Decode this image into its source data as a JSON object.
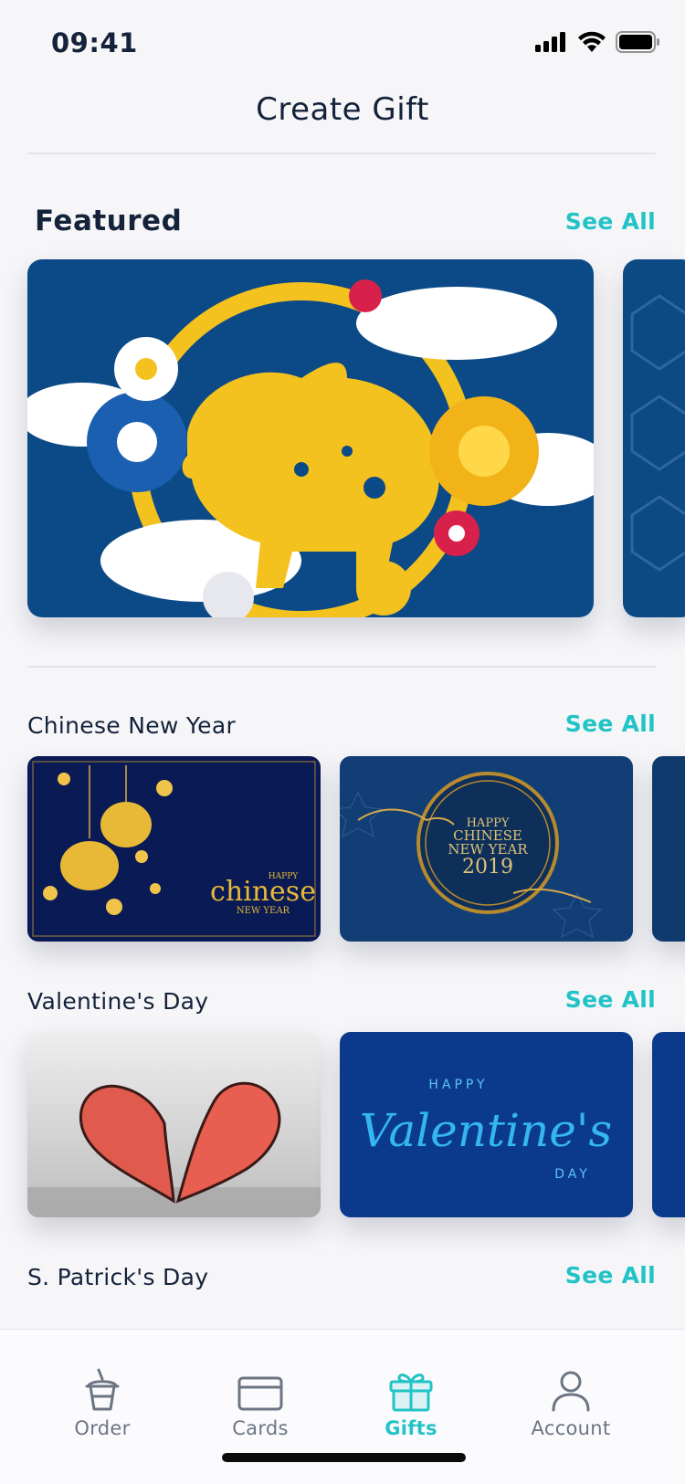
{
  "status_bar": {
    "time": "09:41"
  },
  "header": {
    "title": "Create Gift"
  },
  "featured": {
    "title": "Featured",
    "see_all": "See All"
  },
  "sections": [
    {
      "title": "Chinese New Year",
      "see_all": "See All",
      "card_texts": [
        {
          "happy": "HAPPY",
          "main": "chinese",
          "sub": "NEW YEAR"
        },
        {
          "line1": "HAPPY",
          "line2": "CHINESE",
          "line3": "NEW YEAR",
          "line4": "2019"
        }
      ]
    },
    {
      "title": "Valentine's Day",
      "see_all": "See All",
      "card_texts": [
        {
          "happy": "HAPPY",
          "main": "Valentine's",
          "sub": "DAY"
        }
      ]
    },
    {
      "title": "S. Patrick's Day",
      "see_all": "See All"
    }
  ],
  "tabbar": {
    "items": [
      {
        "label": "Order",
        "icon": "cup-icon"
      },
      {
        "label": "Cards",
        "icon": "card-icon"
      },
      {
        "label": "Gifts",
        "icon": "gift-icon",
        "active": true
      },
      {
        "label": "Account",
        "icon": "user-icon"
      }
    ]
  },
  "colors": {
    "accent": "#22c3c6",
    "navy": "#14223a",
    "card_blue": "#0b4a86",
    "gold": "#f4c21f"
  }
}
